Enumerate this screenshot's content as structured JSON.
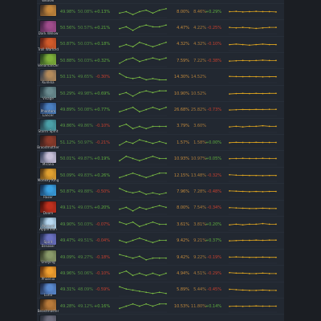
{
  "colors": {
    "page_background": "#1b1e23",
    "panel_background": "#222831",
    "hero_name": "#d0d4da",
    "winrate_text": "#5a9c45",
    "pickrate_text": "#c38a3c",
    "positive": "#5fae3e",
    "negative": "#c8402e",
    "winrate_line": "#7cc043",
    "pickrate_line": "#e3a81f"
  },
  "heroes": [
    {
      "hero": "Weaver",
      "portrait": [
        "#2d2a45",
        "#b0703a"
      ]
    },
    {
      "portrait": [
        "#3a2a20",
        "#c4873c"
      ],
      "win_rate": "49.98%",
      "win_rate_previous": "50.08%",
      "win_rate_change": "+0.13%",
      "win_rate_trend": [
        49.8,
        49.9,
        49.7,
        49.9,
        50.0,
        49.8,
        50.0,
        50.1
      ],
      "pick_rate": "8.00%",
      "pick_rate_previous": "8.46%",
      "pick_rate_change": "+0.29%",
      "pick_rate_trend": [
        8.1,
        8.2,
        8.0,
        8.1,
        8.2,
        8.1,
        8.1,
        8.0
      ]
    },
    {
      "hero": "Dark Willow",
      "portrait": [
        "#3b1f3f",
        "#a04c8c"
      ],
      "win_rate": "50.56%",
      "win_rate_previous": "50.57%",
      "win_rate_change": "+0.21%",
      "win_rate_trend": [
        50.4,
        50.5,
        50.3,
        50.5,
        50.6,
        50.5,
        50.5,
        50.6
      ],
      "pick_rate": "4.47%",
      "pick_rate_previous": "4.22%",
      "pick_rate_change": "-0.25%",
      "pick_rate_trend": [
        4.5,
        4.4,
        4.5,
        4.4,
        4.3,
        4.4,
        4.5,
        4.5
      ]
    },
    {
      "hero": "Troll Warlord",
      "portrait": [
        "#5a1e14",
        "#d05a2a"
      ],
      "win_rate": "50.87%",
      "win_rate_previous": "50.03%",
      "win_rate_change": "+0.18%",
      "win_rate_trend": [
        50.7,
        50.8,
        50.7,
        50.9,
        50.8,
        50.7,
        50.8,
        50.9
      ],
      "pick_rate": "4.32%",
      "pick_rate_previous": "4.32%",
      "pick_rate_change": "-0.10%",
      "pick_rate_trend": [
        4.3,
        4.4,
        4.3,
        4.2,
        4.3,
        4.4,
        4.3,
        4.3
      ]
    },
    {
      "hero": "Venomancer",
      "portrait": [
        "#1f3a1c",
        "#7fb03a"
      ],
      "win_rate": "50.88%",
      "win_rate_previous": "50.03%",
      "win_rate_change": "+0.32%",
      "win_rate_trend": [
        50.6,
        50.8,
        50.9,
        50.7,
        50.8,
        50.9,
        50.8,
        50.9
      ],
      "pick_rate": "7.59%",
      "pick_rate_previous": "7.22%",
      "pick_rate_change": "-0.38%",
      "pick_rate_trend": [
        7.4,
        7.5,
        7.6,
        7.5,
        7.6,
        7.7,
        7.6,
        7.6
      ]
    },
    {
      "hero": "Kunkka",
      "portrait": [
        "#22324a",
        "#b48a5a"
      ],
      "win_rate": "50.11%",
      "win_rate_previous": "49.65%",
      "win_rate_change": "-0.30%",
      "win_rate_trend": [
        50.6,
        50.3,
        50.2,
        50.3,
        50.1,
        50.2,
        50.1,
        50.1
      ],
      "pick_rate": "14.30%",
      "pick_rate_previous": "14.52%",
      "pick_rate_trend": [
        14.5,
        14.4,
        14.3,
        14.4,
        14.3,
        14.2,
        14.3,
        14.3
      ]
    },
    {
      "hero": "Visage",
      "portrait": [
        "#1e3038",
        "#6b8c90"
      ],
      "win_rate": "50.29%",
      "win_rate_previous": "49.98%",
      "win_rate_change": "+0.69%",
      "win_rate_trend": [
        50.1,
        50.2,
        50.0,
        50.2,
        50.3,
        50.2,
        50.3,
        50.3
      ],
      "pick_rate": "10.90%",
      "pick_rate_previous": "10.52%",
      "pick_rate_trend": [
        10.6,
        10.8,
        10.9,
        10.8,
        10.9,
        10.8,
        10.9,
        10.9
      ]
    },
    {
      "hero": "Phantom Lancer",
      "portrait": [
        "#1a2a4a",
        "#4a7fc0"
      ],
      "win_rate": "49.89%",
      "win_rate_previous": "50.08%",
      "win_rate_change": "+0.77%",
      "win_rate_trend": [
        49.7,
        49.8,
        49.9,
        49.7,
        49.8,
        49.9,
        49.8,
        49.9
      ],
      "pick_rate": "26.68%",
      "pick_rate_previous": "25.82%",
      "pick_rate_change": "-0.73%",
      "pick_rate_trend": [
        25.9,
        26.2,
        26.5,
        26.4,
        26.6,
        26.5,
        26.7,
        26.7
      ]
    },
    {
      "hero": "Storm Spirit",
      "portrait": [
        "#1f2e3a",
        "#4aa0a8"
      ],
      "win_rate": "49.86%",
      "win_rate_previous": "49.86%",
      "win_rate_change": "-0.10%",
      "win_rate_trend": [
        49.9,
        50.0,
        49.8,
        49.9,
        49.8,
        49.9,
        49.9,
        49.9
      ],
      "pick_rate": "3.79%",
      "pick_rate_previous": "3.60%",
      "pick_rate_trend": [
        3.7,
        3.8,
        3.7,
        3.8,
        3.8,
        3.9,
        3.8,
        3.8
      ]
    },
    {
      "hero": "Broodmother",
      "portrait": [
        "#2a1a1a",
        "#8a3a2a"
      ],
      "win_rate": "51.12%",
      "win_rate_previous": "50.97%",
      "win_rate_change": "-0.21%",
      "win_rate_trend": [
        51.0,
        51.2,
        51.1,
        51.3,
        51.2,
        51.1,
        51.2,
        51.1
      ],
      "pick_rate": "1.57%",
      "pick_rate_previous": "1.58%",
      "pick_rate_change": "+0.00%",
      "pick_rate_trend": [
        1.55,
        1.58,
        1.57,
        1.56,
        1.58,
        1.57,
        1.57,
        1.57
      ]
    },
    {
      "hero": "Mirana",
      "portrait": [
        "#2a3550",
        "#c8c0d8"
      ],
      "win_rate": "50.01%",
      "win_rate_previous": "49.87%",
      "win_rate_change": "+0.19%",
      "win_rate_trend": [
        49.9,
        50.1,
        50.0,
        49.9,
        50.0,
        50.1,
        50.0,
        50.0
      ],
      "pick_rate": "10.93%",
      "pick_rate_previous": "10.97%",
      "pick_rate_change": "+0.05%",
      "pick_rate_trend": [
        10.8,
        10.9,
        11.0,
        10.9,
        10.9,
        11.0,
        10.9,
        10.9
      ]
    },
    {
      "hero": "Monkey King",
      "portrait": [
        "#4a3010",
        "#e0a030"
      ],
      "win_rate": "50.09%",
      "win_rate_previous": "49.83%",
      "win_rate_change": "+0.26%",
      "win_rate_trend": [
        49.9,
        50.0,
        50.1,
        50.0,
        49.9,
        50.0,
        50.1,
        50.1
      ],
      "pick_rate": "12.15%",
      "pick_rate_previous": "13.48%",
      "pick_rate_change": "-0.32%",
      "pick_rate_trend": [
        12.6,
        12.4,
        12.3,
        12.2,
        12.2,
        12.1,
        12.2,
        12.2
      ]
    },
    {
      "hero": "Razor",
      "portrait": [
        "#10284a",
        "#3aa0e0"
      ],
      "win_rate": "50.87%",
      "win_rate_previous": "49.88%",
      "win_rate_change": "-0.50%",
      "win_rate_trend": [
        51.2,
        51.0,
        50.9,
        51.0,
        50.8,
        50.9,
        50.8,
        50.9
      ],
      "pick_rate": "7.96%",
      "pick_rate_previous": "7.28%",
      "pick_rate_change": "-0.48%",
      "pick_rate_trend": [
        8.2,
        8.1,
        8.0,
        7.9,
        8.0,
        7.9,
        8.0,
        8.0
      ]
    },
    {
      "hero": "Doom",
      "portrait": [
        "#3a0e0a",
        "#c0301e"
      ],
      "win_rate": "49.11%",
      "win_rate_previous": "49.03%",
      "win_rate_change": "+0.20%",
      "win_rate_trend": [
        49.0,
        49.1,
        48.9,
        49.1,
        49.0,
        49.1,
        49.2,
        49.1
      ],
      "pick_rate": "8.00%",
      "pick_rate_previous": "7.54%",
      "pick_rate_change": "-0.34%",
      "pick_rate_trend": [
        8.3,
        8.2,
        8.1,
        8.0,
        8.0,
        8.1,
        8.0,
        8.0
      ]
    },
    {
      "hero": "Ancient Apparition",
      "portrait": [
        "#2a4050",
        "#b8d8f0"
      ],
      "win_rate": "49.90%",
      "win_rate_previous": "50.03%",
      "win_rate_change": "-0.07%",
      "win_rate_trend": [
        50.0,
        49.9,
        50.0,
        49.8,
        49.9,
        50.0,
        49.9,
        49.9
      ],
      "pick_rate": "3.61%",
      "pick_rate_previous": "3.81%",
      "pick_rate_change": "+0.20%",
      "pick_rate_trend": [
        3.5,
        3.6,
        3.5,
        3.6,
        3.6,
        3.7,
        3.6,
        3.6
      ]
    },
    {
      "hero": "Spirit Breaker",
      "portrait": [
        "#202848",
        "#6a70c0"
      ],
      "win_rate": "49.47%",
      "win_rate_previous": "49.51%",
      "win_rate_change": "-0.04%",
      "win_rate_trend": [
        49.5,
        49.4,
        49.5,
        49.6,
        49.5,
        49.4,
        49.5,
        49.5
      ],
      "pick_rate": "9.42%",
      "pick_rate_previous": "9.21%",
      "pick_rate_change": "+0.37%",
      "pick_rate_trend": [
        9.1,
        9.2,
        9.3,
        9.3,
        9.4,
        9.3,
        9.4,
        9.4
      ]
    },
    {
      "hero": "Undying",
      "portrait": [
        "#2a3020",
        "#8a9a6a"
      ],
      "win_rate": "49.09%",
      "win_rate_previous": "49.27%",
      "win_rate_change": "-0.18%",
      "win_rate_trend": [
        49.3,
        49.2,
        49.1,
        49.2,
        49.0,
        49.1,
        49.1,
        49.1
      ],
      "pick_rate": "9.42%",
      "pick_rate_previous": "9.22%",
      "pick_rate_change": "-0.19%",
      "pick_rate_trend": [
        9.5,
        9.6,
        9.5,
        9.4,
        9.4,
        9.5,
        9.4,
        9.4
      ]
    },
    {
      "hero": "Phoenix",
      "portrait": [
        "#5a2a0a",
        "#f0a030"
      ],
      "win_rate": "49.96%",
      "win_rate_previous": "50.06%",
      "win_rate_change": "-0.10%",
      "win_rate_trend": [
        50.0,
        50.1,
        49.9,
        50.0,
        49.9,
        50.0,
        49.9,
        50.0
      ],
      "pick_rate": "4.94%",
      "pick_rate_previous": "4.51%",
      "pick_rate_change": "-0.29%",
      "pick_rate_trend": [
        5.1,
        5.0,
        5.0,
        4.9,
        4.9,
        5.0,
        4.9,
        4.9
      ]
    },
    {
      "hero": "Luna",
      "portrait": [
        "#1a2440",
        "#5a8ad0"
      ],
      "win_rate": "49.31%",
      "win_rate_previous": "48.09%",
      "win_rate_change": "-0.59%",
      "win_rate_trend": [
        49.9,
        49.7,
        49.6,
        49.5,
        49.4,
        49.3,
        49.4,
        49.3
      ],
      "pick_rate": "5.89%",
      "pick_rate_previous": "5.44%",
      "pick_rate_change": "-0.45%",
      "pick_rate_trend": [
        6.2,
        6.1,
        6.0,
        5.9,
        5.9,
        6.0,
        5.9,
        5.9
      ]
    },
    {
      "hero": "Beastmaster",
      "portrait": [
        "#3a2410",
        "#b87a3a"
      ],
      "win_rate": "49.28%",
      "win_rate_previous": "49.12%",
      "win_rate_change": "+0.16%",
      "win_rate_trend": [
        49.1,
        49.2,
        49.3,
        49.2,
        49.3,
        49.2,
        49.3,
        49.3
      ],
      "pick_rate": "10.53%",
      "pick_rate_previous": "11.80%",
      "pick_rate_change": "+0.14%",
      "pick_rate_trend": [
        10.4,
        10.5,
        10.4,
        10.5,
        10.6,
        10.5,
        10.5,
        10.5
      ]
    },
    {
      "portrait": [
        "#2a2f3a",
        "#6a6a7a"
      ]
    }
  ]
}
